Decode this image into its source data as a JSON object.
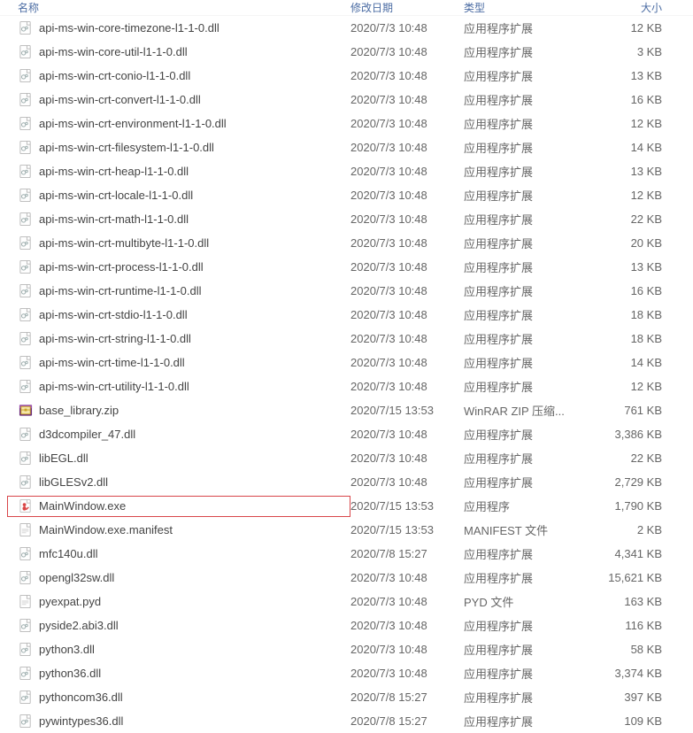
{
  "columns": {
    "name": "名称",
    "date": "修改日期",
    "type": "类型",
    "size": "大小"
  },
  "icons": {
    "dll": "dll-icon",
    "zip": "zip-icon",
    "exe": "exe-icon",
    "file": "file-icon",
    "manifest": "file-icon",
    "pyd": "file-icon"
  },
  "files": [
    {
      "icon": "dll",
      "name": "api-ms-win-core-timezone-l1-1-0.dll",
      "date": "2020/7/3 10:48",
      "type": "应用程序扩展",
      "size": "12 KB",
      "highlighted": false
    },
    {
      "icon": "dll",
      "name": "api-ms-win-core-util-l1-1-0.dll",
      "date": "2020/7/3 10:48",
      "type": "应用程序扩展",
      "size": "3 KB",
      "highlighted": false
    },
    {
      "icon": "dll",
      "name": "api-ms-win-crt-conio-l1-1-0.dll",
      "date": "2020/7/3 10:48",
      "type": "应用程序扩展",
      "size": "13 KB",
      "highlighted": false
    },
    {
      "icon": "dll",
      "name": "api-ms-win-crt-convert-l1-1-0.dll",
      "date": "2020/7/3 10:48",
      "type": "应用程序扩展",
      "size": "16 KB",
      "highlighted": false
    },
    {
      "icon": "dll",
      "name": "api-ms-win-crt-environment-l1-1-0.dll",
      "date": "2020/7/3 10:48",
      "type": "应用程序扩展",
      "size": "12 KB",
      "highlighted": false
    },
    {
      "icon": "dll",
      "name": "api-ms-win-crt-filesystem-l1-1-0.dll",
      "date": "2020/7/3 10:48",
      "type": "应用程序扩展",
      "size": "14 KB",
      "highlighted": false
    },
    {
      "icon": "dll",
      "name": "api-ms-win-crt-heap-l1-1-0.dll",
      "date": "2020/7/3 10:48",
      "type": "应用程序扩展",
      "size": "13 KB",
      "highlighted": false
    },
    {
      "icon": "dll",
      "name": "api-ms-win-crt-locale-l1-1-0.dll",
      "date": "2020/7/3 10:48",
      "type": "应用程序扩展",
      "size": "12 KB",
      "highlighted": false
    },
    {
      "icon": "dll",
      "name": "api-ms-win-crt-math-l1-1-0.dll",
      "date": "2020/7/3 10:48",
      "type": "应用程序扩展",
      "size": "22 KB",
      "highlighted": false
    },
    {
      "icon": "dll",
      "name": "api-ms-win-crt-multibyte-l1-1-0.dll",
      "date": "2020/7/3 10:48",
      "type": "应用程序扩展",
      "size": "20 KB",
      "highlighted": false
    },
    {
      "icon": "dll",
      "name": "api-ms-win-crt-process-l1-1-0.dll",
      "date": "2020/7/3 10:48",
      "type": "应用程序扩展",
      "size": "13 KB",
      "highlighted": false
    },
    {
      "icon": "dll",
      "name": "api-ms-win-crt-runtime-l1-1-0.dll",
      "date": "2020/7/3 10:48",
      "type": "应用程序扩展",
      "size": "16 KB",
      "highlighted": false
    },
    {
      "icon": "dll",
      "name": "api-ms-win-crt-stdio-l1-1-0.dll",
      "date": "2020/7/3 10:48",
      "type": "应用程序扩展",
      "size": "18 KB",
      "highlighted": false
    },
    {
      "icon": "dll",
      "name": "api-ms-win-crt-string-l1-1-0.dll",
      "date": "2020/7/3 10:48",
      "type": "应用程序扩展",
      "size": "18 KB",
      "highlighted": false
    },
    {
      "icon": "dll",
      "name": "api-ms-win-crt-time-l1-1-0.dll",
      "date": "2020/7/3 10:48",
      "type": "应用程序扩展",
      "size": "14 KB",
      "highlighted": false
    },
    {
      "icon": "dll",
      "name": "api-ms-win-crt-utility-l1-1-0.dll",
      "date": "2020/7/3 10:48",
      "type": "应用程序扩展",
      "size": "12 KB",
      "highlighted": false
    },
    {
      "icon": "zip",
      "name": "base_library.zip",
      "date": "2020/7/15 13:53",
      "type": "WinRAR ZIP 压缩...",
      "size": "761 KB",
      "highlighted": false
    },
    {
      "icon": "dll",
      "name": "d3dcompiler_47.dll",
      "date": "2020/7/3 10:48",
      "type": "应用程序扩展",
      "size": "3,386 KB",
      "highlighted": false
    },
    {
      "icon": "dll",
      "name": "libEGL.dll",
      "date": "2020/7/3 10:48",
      "type": "应用程序扩展",
      "size": "22 KB",
      "highlighted": false
    },
    {
      "icon": "dll",
      "name": "libGLESv2.dll",
      "date": "2020/7/3 10:48",
      "type": "应用程序扩展",
      "size": "2,729 KB",
      "highlighted": false
    },
    {
      "icon": "exe",
      "name": "MainWindow.exe",
      "date": "2020/7/15 13:53",
      "type": "应用程序",
      "size": "1,790 KB",
      "highlighted": true
    },
    {
      "icon": "file",
      "name": "MainWindow.exe.manifest",
      "date": "2020/7/15 13:53",
      "type": "MANIFEST 文件",
      "size": "2 KB",
      "highlighted": false
    },
    {
      "icon": "dll",
      "name": "mfc140u.dll",
      "date": "2020/7/8 15:27",
      "type": "应用程序扩展",
      "size": "4,341 KB",
      "highlighted": false
    },
    {
      "icon": "dll",
      "name": "opengl32sw.dll",
      "date": "2020/7/3 10:48",
      "type": "应用程序扩展",
      "size": "15,621 KB",
      "highlighted": false
    },
    {
      "icon": "file",
      "name": "pyexpat.pyd",
      "date": "2020/7/3 10:48",
      "type": "PYD 文件",
      "size": "163 KB",
      "highlighted": false
    },
    {
      "icon": "dll",
      "name": "pyside2.abi3.dll",
      "date": "2020/7/3 10:48",
      "type": "应用程序扩展",
      "size": "116 KB",
      "highlighted": false
    },
    {
      "icon": "dll",
      "name": "python3.dll",
      "date": "2020/7/3 10:48",
      "type": "应用程序扩展",
      "size": "58 KB",
      "highlighted": false
    },
    {
      "icon": "dll",
      "name": "python36.dll",
      "date": "2020/7/3 10:48",
      "type": "应用程序扩展",
      "size": "3,374 KB",
      "highlighted": false
    },
    {
      "icon": "dll",
      "name": "pythoncom36.dll",
      "date": "2020/7/8 15:27",
      "type": "应用程序扩展",
      "size": "397 KB",
      "highlighted": false
    },
    {
      "icon": "dll",
      "name": "pywintypes36.dll",
      "date": "2020/7/8 15:27",
      "type": "应用程序扩展",
      "size": "109 KB",
      "highlighted": false
    }
  ]
}
